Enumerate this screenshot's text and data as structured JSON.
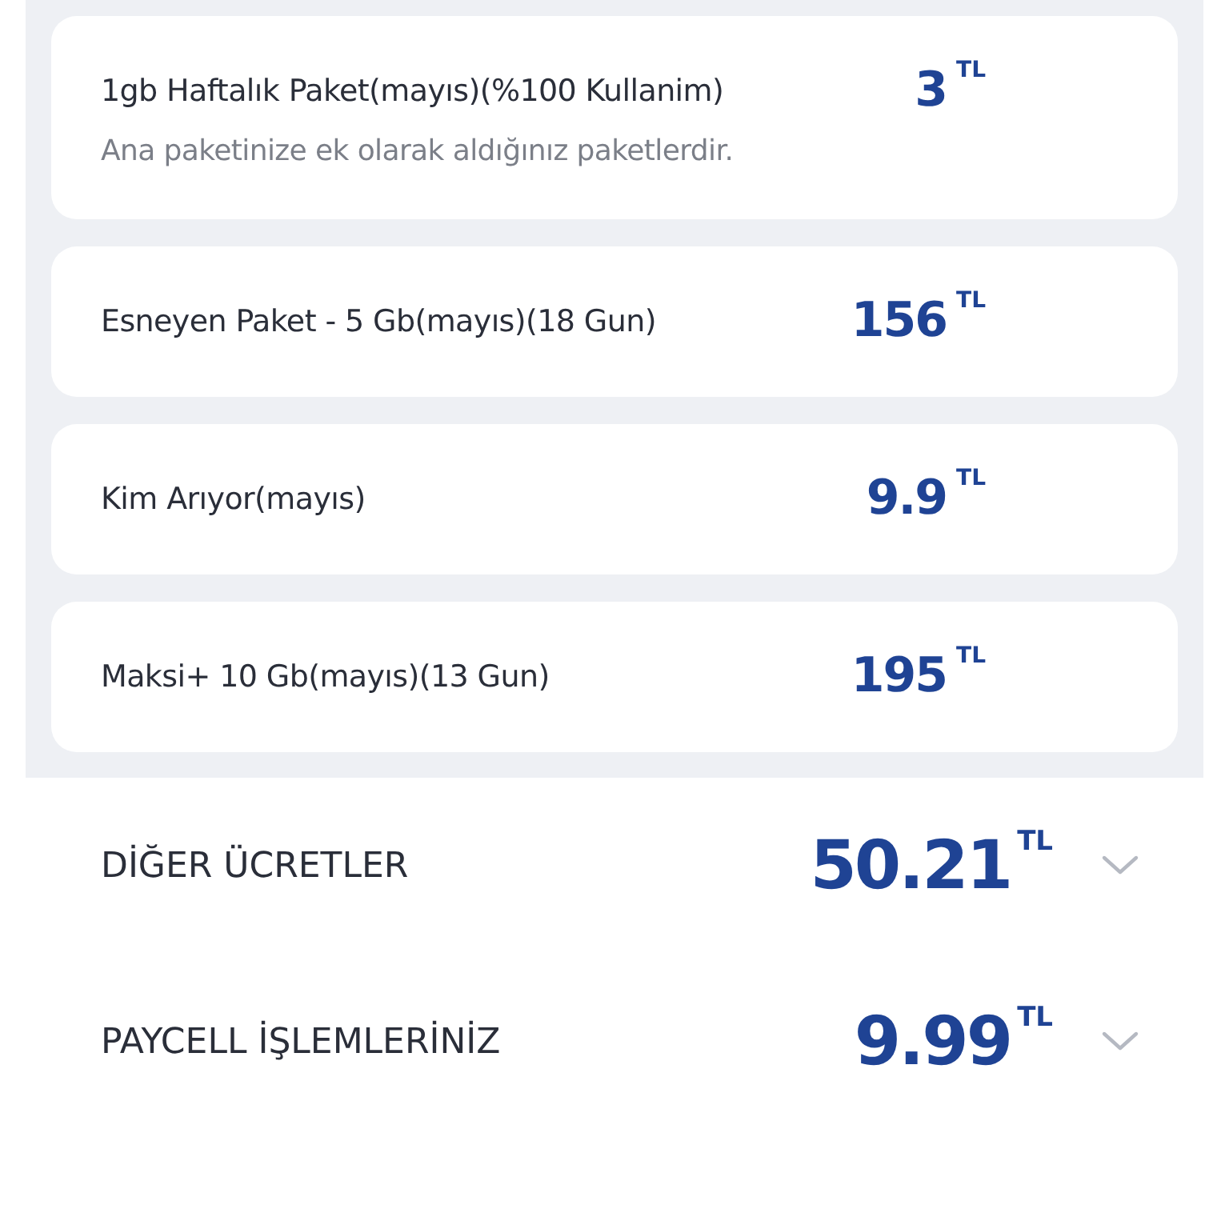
{
  "packages": [
    {
      "name": "1gb Haftalık Paket(mayıs)(%100 Kullanim)",
      "price": "3",
      "currency": "TL",
      "note": "Ana paketinize ek olarak aldığınız paketlerdir."
    },
    {
      "name": "Esneyen Paket - 5 Gb(mayıs)(18 Gun)",
      "price": "156",
      "currency": "TL"
    },
    {
      "name": "Kim Arıyor(mayıs)",
      "price": "9.9",
      "currency": "TL"
    },
    {
      "name": "Maksi+ 10 Gb(mayıs)(13 Gun)",
      "price": "195",
      "currency": "TL"
    }
  ],
  "sections": [
    {
      "title": "DİĞER ÜCRETLER",
      "amount": "50.21",
      "currency": "TL",
      "expanded": false
    },
    {
      "title": "PAYCELL İŞLEMLERİNİZ",
      "amount": "9.99",
      "currency": "TL",
      "expanded": false
    }
  ]
}
